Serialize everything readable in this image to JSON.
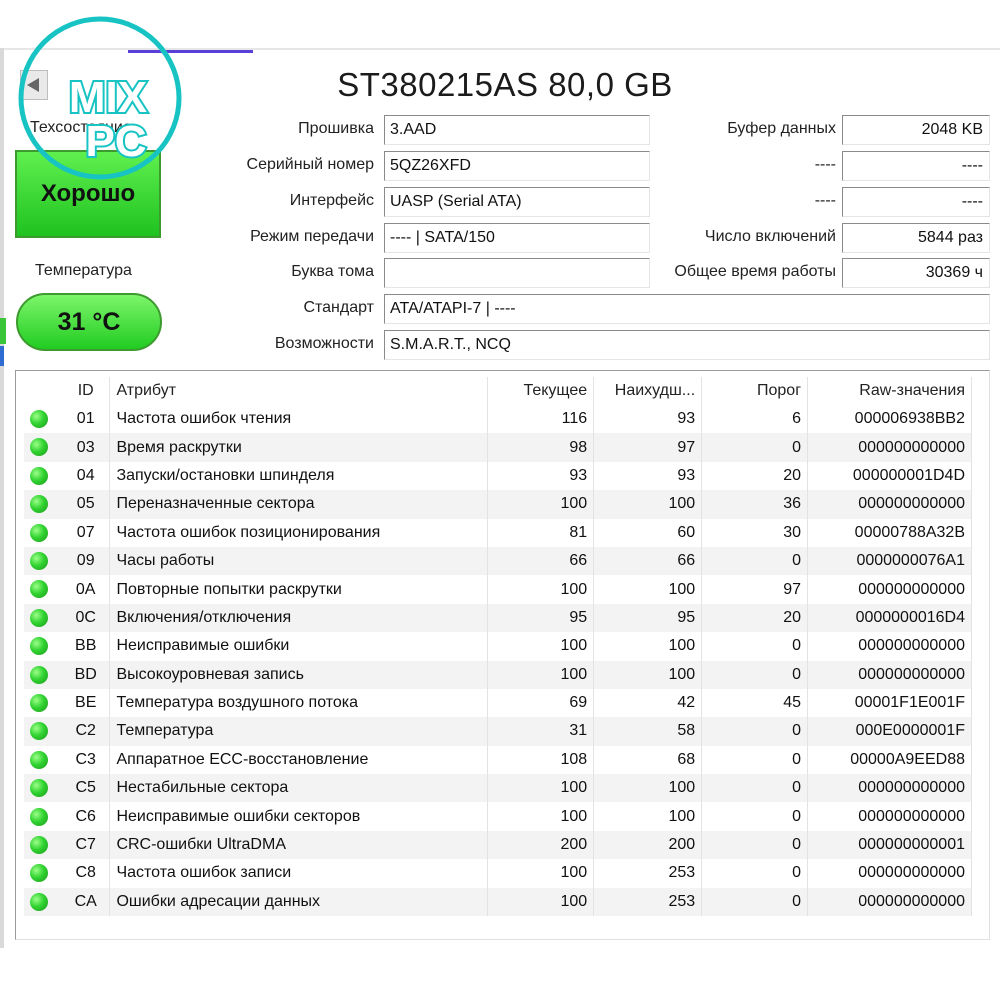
{
  "drive": {
    "title": "ST380215AS 80,0 GB"
  },
  "health": {
    "label": "Техсостояние",
    "status": "Хорошо",
    "color": "#2fd12f"
  },
  "temperature": {
    "label": "Температура",
    "value": "31 °C"
  },
  "fields_left": [
    {
      "label": "Прошивка",
      "value": "3.AAD"
    },
    {
      "label": "Серийный номер",
      "value": "5QZ26XFD"
    },
    {
      "label": "Интерфейс",
      "value": "UASP (Serial ATA)"
    },
    {
      "label": "Режим передачи",
      "value": "---- | SATA/150"
    },
    {
      "label": "Буква тома",
      "value": ""
    },
    {
      "label": "Стандарт",
      "value": "ATA/ATAPI-7 | ----"
    },
    {
      "label": "Возможности",
      "value": "S.M.A.R.T., NCQ"
    }
  ],
  "fields_right": [
    {
      "label": "Буфер данных",
      "value": "2048 KB"
    },
    {
      "label": "----",
      "value": "----"
    },
    {
      "label": "----",
      "value": "----"
    },
    {
      "label": "Число включений",
      "value": "5844 раз"
    },
    {
      "label": "Общее время работы",
      "value": "30369 ч"
    }
  ],
  "smart": {
    "columns": [
      "ID",
      "Атрибут",
      "Текущее",
      "Наихудш...",
      "Порог",
      "Raw-значения"
    ],
    "rows": [
      {
        "id": "01",
        "name": "Частота ошибок чтения",
        "current": "116",
        "worst": "93",
        "threshold": "6",
        "raw": "000006938BB2"
      },
      {
        "id": "03",
        "name": "Время раскрутки",
        "current": "98",
        "worst": "97",
        "threshold": "0",
        "raw": "000000000000"
      },
      {
        "id": "04",
        "name": "Запуски/остановки шпинделя",
        "current": "93",
        "worst": "93",
        "threshold": "20",
        "raw": "000000001D4D"
      },
      {
        "id": "05",
        "name": "Переназначенные сектора",
        "current": "100",
        "worst": "100",
        "threshold": "36",
        "raw": "000000000000"
      },
      {
        "id": "07",
        "name": "Частота ошибок позиционирования",
        "current": "81",
        "worst": "60",
        "threshold": "30",
        "raw": "00000788A32B"
      },
      {
        "id": "09",
        "name": "Часы работы",
        "current": "66",
        "worst": "66",
        "threshold": "0",
        "raw": "0000000076A1"
      },
      {
        "id": "0A",
        "name": "Повторные попытки раскрутки",
        "current": "100",
        "worst": "100",
        "threshold": "97",
        "raw": "000000000000"
      },
      {
        "id": "0C",
        "name": "Включения/отключения",
        "current": "95",
        "worst": "95",
        "threshold": "20",
        "raw": "0000000016D4"
      },
      {
        "id": "BB",
        "name": "Неисправимые ошибки",
        "current": "100",
        "worst": "100",
        "threshold": "0",
        "raw": "000000000000"
      },
      {
        "id": "BD",
        "name": "Высокоуровневая запись",
        "current": "100",
        "worst": "100",
        "threshold": "0",
        "raw": "000000000000"
      },
      {
        "id": "BE",
        "name": "Температура воздушного потока",
        "current": "69",
        "worst": "42",
        "threshold": "45",
        "raw": "00001F1E001F"
      },
      {
        "id": "C2",
        "name": "Температура",
        "current": "31",
        "worst": "58",
        "threshold": "0",
        "raw": "000E0000001F"
      },
      {
        "id": "C3",
        "name": "Аппаратное ECC-восстановление",
        "current": "108",
        "worst": "68",
        "threshold": "0",
        "raw": "00000A9EED88"
      },
      {
        "id": "C5",
        "name": "Нестабильные сектора",
        "current": "100",
        "worst": "100",
        "threshold": "0",
        "raw": "000000000000"
      },
      {
        "id": "C6",
        "name": "Неисправимые ошибки секторов",
        "current": "100",
        "worst": "100",
        "threshold": "0",
        "raw": "000000000000"
      },
      {
        "id": "C7",
        "name": "CRC-ошибки UltraDMA",
        "current": "200",
        "worst": "200",
        "threshold": "0",
        "raw": "000000000001"
      },
      {
        "id": "C8",
        "name": "Частота ошибок записи",
        "current": "100",
        "worst": "253",
        "threshold": "0",
        "raw": "000000000000"
      },
      {
        "id": "CA",
        "name": "Ошибки адресации данных",
        "current": "100",
        "worst": "253",
        "threshold": "0",
        "raw": "000000000000"
      }
    ]
  },
  "logo": {
    "line1": "MIX",
    "line2": "PC",
    "color": "#17c3c3"
  }
}
